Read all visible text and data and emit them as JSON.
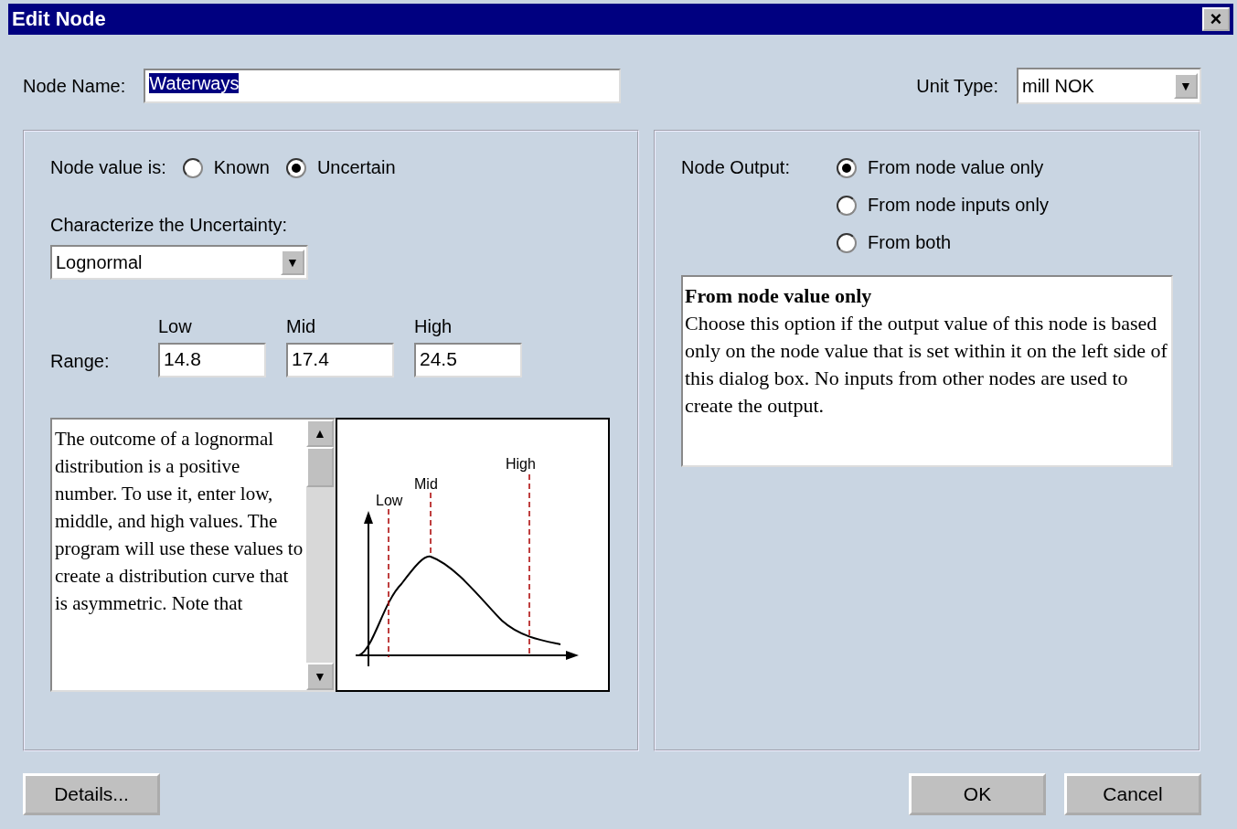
{
  "window": {
    "title": "Edit Node",
    "close": "×"
  },
  "node_name": {
    "label": "Node Name:",
    "value": "Waterways"
  },
  "unit_type": {
    "label": "Unit Type:",
    "value": "mill NOK",
    "arrow": "▼"
  },
  "node_value": {
    "label": "Node value is:",
    "options": [
      {
        "label": "Known",
        "selected": false
      },
      {
        "label": "Uncertain",
        "selected": true
      }
    ]
  },
  "characterize": {
    "label": "Characterize the Uncertainty:",
    "value": "Lognormal",
    "arrow": "▼"
  },
  "range": {
    "label": "Range:",
    "fields": [
      {
        "label": "Low",
        "value": "14.8"
      },
      {
        "label": "Mid",
        "value": "17.4"
      },
      {
        "label": "High",
        "value": "24.5"
      }
    ]
  },
  "description": {
    "text": "The outcome of a lognormal distribution is a positive number. To use it, enter low, middle, and high values.  The program will use these values to create a distribution curve that is asymmetric.  Note that",
    "up": "▲",
    "down": "▼"
  },
  "curve": {
    "labels": [
      "Low",
      "Mid",
      "High"
    ]
  },
  "node_output": {
    "label": "Node Output:",
    "options": [
      {
        "label": "From node value only",
        "selected": true
      },
      {
        "label": "From node inputs only",
        "selected": false
      },
      {
        "label": "From both",
        "selected": false
      }
    ]
  },
  "help": {
    "title": "From node value only",
    "text": "Choose this option if the output value of this node is based only on the node value that is set within it on the left side of this dialog box.  No inputs from other nodes are used to create the output."
  },
  "buttons": [
    {
      "label": "Details...",
      "kind": "left"
    },
    {
      "label": "OK",
      "kind": "right"
    },
    {
      "label": "Cancel",
      "kind": "right"
    }
  ]
}
